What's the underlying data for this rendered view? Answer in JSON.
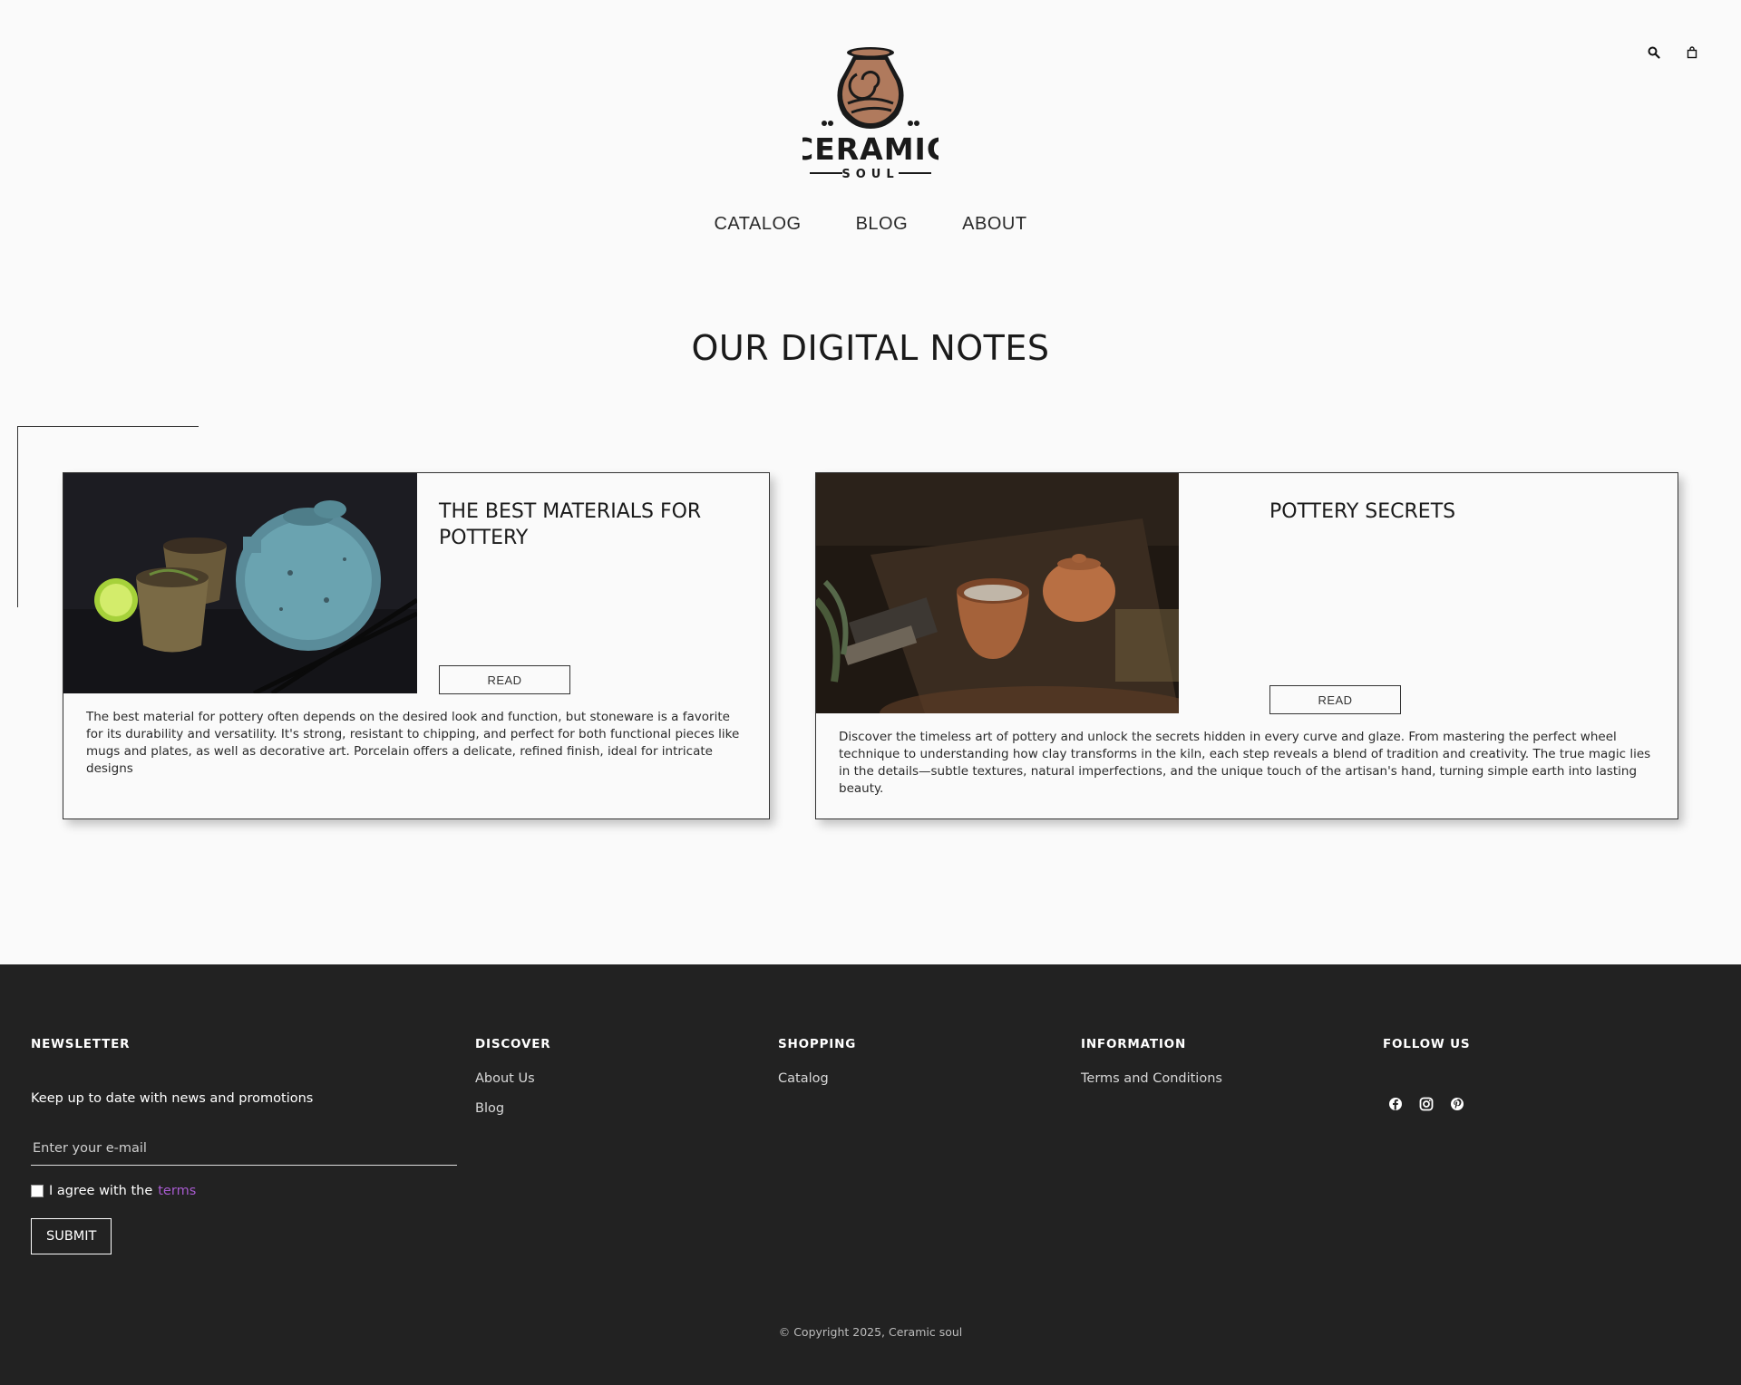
{
  "header": {
    "search_icon": "search-icon",
    "cart_icon": "shopping-bag-icon",
    "logo": {
      "name": "CERAMIC",
      "sub": "SOUL"
    }
  },
  "nav": {
    "items": [
      {
        "label": "CATALOG"
      },
      {
        "label": "BLOG"
      },
      {
        "label": "ABOUT"
      }
    ]
  },
  "main": {
    "section_title": "OUR DIGITAL NOTES",
    "posts": [
      {
        "title": "THE BEST MATERIALS FOR POTTERY",
        "button": "READ",
        "text": "The best material for pottery often depends on the desired look and function, but stoneware is a favorite for its durability and versatility. It's strong, resistant to chipping, and perfect for both functional pieces like mugs and plates, as well as decorative art. Porcelain offers a delicate, refined finish, ideal for intricate designs"
      },
      {
        "title": "POTTERY SECRETS",
        "button": "READ",
        "text": "Discover the timeless art of pottery and unlock the secrets hidden in every curve and glaze. From mastering the perfect wheel technique to understanding how clay transforms in the kiln, each step reveals a blend of tradition and creativity. The true magic lies in the details—subtle textures, natural imperfections, and the unique touch of the artisan's hand, turning simple earth into lasting beauty."
      }
    ]
  },
  "footer": {
    "newsletter": {
      "heading": "NEWSLETTER",
      "text": "Keep up to date with news and promotions",
      "email_placeholder": "Enter your e-mail",
      "agree_prefix": "I agree with the",
      "agree_link": "terms",
      "submit": "SUBMIT"
    },
    "discover": {
      "heading": "DISCOVER",
      "links": [
        "About Us",
        "Blog"
      ]
    },
    "shopping": {
      "heading": "SHOPPING",
      "links": [
        "Catalog"
      ]
    },
    "information": {
      "heading": "INFORMATION",
      "links": [
        "Terms and Conditions"
      ]
    },
    "follow": {
      "heading": "FOLLOW US",
      "icons": [
        "facebook-icon",
        "instagram-icon",
        "pinterest-icon"
      ]
    },
    "copyright": "© Copyright 2025, Ceramic soul"
  },
  "colors": {
    "background": "#fafafa",
    "footer_bg": "#222222",
    "terms_link": "#a85bd0"
  }
}
